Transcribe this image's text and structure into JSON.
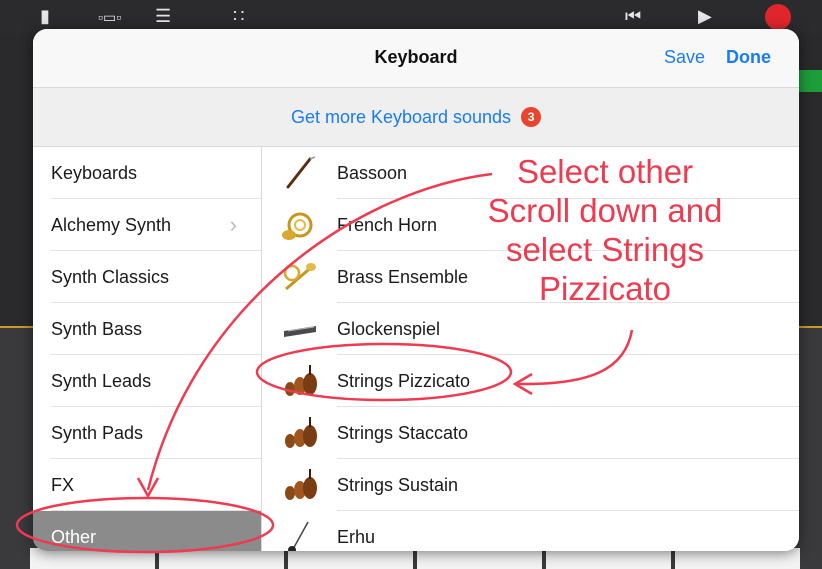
{
  "modal": {
    "title": "Keyboard",
    "save_label": "Save",
    "done_label": "Done"
  },
  "more_sounds": {
    "label": "Get more Keyboard sounds",
    "badge": "3"
  },
  "categories": [
    {
      "label": "Keyboards"
    },
    {
      "label": "Alchemy Synth",
      "chevron": "›"
    },
    {
      "label": "Synth Classics"
    },
    {
      "label": "Synth Bass"
    },
    {
      "label": "Synth Leads"
    },
    {
      "label": "Synth Pads"
    },
    {
      "label": "FX"
    },
    {
      "label": "Other",
      "selected": true
    }
  ],
  "instruments": [
    {
      "label": "Bassoon",
      "icon": "bassoon-icon"
    },
    {
      "label": "French Horn",
      "icon": "french-horn-icon"
    },
    {
      "label": "Brass Ensemble",
      "icon": "brass-ensemble-icon"
    },
    {
      "label": "Glockenspiel",
      "icon": "glockenspiel-icon"
    },
    {
      "label": "Strings Pizzicato",
      "icon": "strings-icon"
    },
    {
      "label": "Strings Staccato",
      "icon": "strings-icon"
    },
    {
      "label": "Strings Sustain",
      "icon": "strings-icon"
    },
    {
      "label": "Erhu",
      "icon": "erhu-icon"
    }
  ],
  "annotation": {
    "lines": [
      "Select other",
      "Scroll down and",
      "select Strings",
      "Pizzicato"
    ],
    "color": "#ee3b4f"
  },
  "colors": {
    "accent": "#1a7cf2",
    "badge": "#e8442e",
    "selected_row": "#8b8b8b"
  }
}
